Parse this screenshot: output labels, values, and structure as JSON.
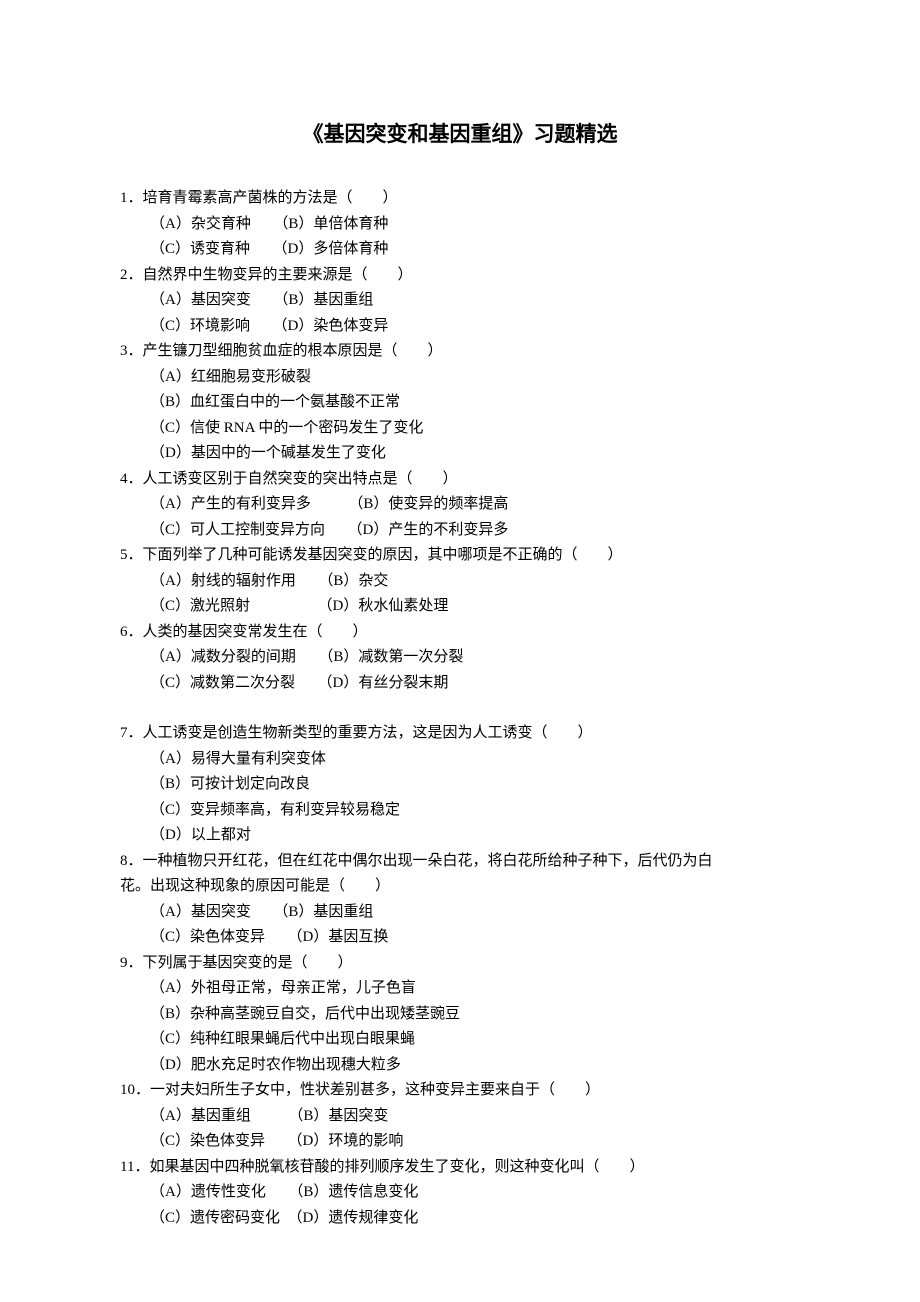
{
  "title": "《基因突变和基因重组》习题精选",
  "questions": [
    {
      "stem": "1．培育青霉素高产菌株的方法是（　　）",
      "options": [
        "（A）杂交育种　　（B）单倍体育种",
        "（C）诱变育种　　（D）多倍体育种"
      ]
    },
    {
      "stem": "2．自然界中生物变异的主要来源是（　　）",
      "options": [
        "（A）基因突变　　（B）基因重组",
        "（C）环境影响　　（D）染色体变异"
      ]
    },
    {
      "stem": "3．产生镰刀型细胞贫血症的根本原因是（　　）",
      "options": [
        "（A）红细胞易变形破裂",
        "（B）血红蛋白中的一个氨基酸不正常",
        "（C）信使 RNA 中的一个密码发生了变化",
        "（D）基因中的一个碱基发生了变化"
      ]
    },
    {
      "stem": "4．人工诱变区别于自然突变的突出特点是（　　）",
      "options": [
        "（A）产生的有利变异多　　　（B）使变异的频率提高",
        "（C）可人工控制变异方向　　（D）产生的不利变异多"
      ]
    },
    {
      "stem": "5．下面列举了几种可能诱发基因突变的原因，其中哪项是不正确的（　　）",
      "options": [
        "（A）射线的辐射作用　　（B）杂交",
        "（C）激光照射　　　　　（D）秋水仙素处理"
      ]
    },
    {
      "stem": "6．人类的基因突变常发生在（　　）",
      "options": [
        "（A）减数分裂的间期　　（B）减数第一次分裂",
        "（C）减数第二次分裂　　（D）有丝分裂末期"
      ],
      "spacerAfter": true
    },
    {
      "stem": "7．人工诱变是创造生物新类型的重要方法，这是因为人工诱变（　　）",
      "options": [
        "（A）易得大量有利突变体",
        "（B）可按计划定向改良",
        "（C）变异频率高，有利变异较易稳定",
        "（D）以上都对"
      ]
    },
    {
      "stem": "8．一种植物只开红花，但在红花中偶尔出现一朵白花，将白花所给种子种下，后代仍为白",
      "cont": "花。出现这种现象的原因可能是（　　）",
      "options": [
        "（A）基因突变　　（B）基因重组",
        "（C）染色体变异　　（D）基因互换"
      ]
    },
    {
      "stem": "9．下列属于基因突变的是（　　）",
      "options": [
        "（A）外祖母正常，母亲正常，儿子色盲",
        "（B）杂种高茎豌豆自交，后代中出现矮茎豌豆",
        "（C）纯种红眼果蝇后代中出现白眼果蝇",
        "（D）肥水充足时农作物出现穗大粒多"
      ]
    },
    {
      "stem": "10．一对夫妇所生子女中，性状差别甚多，这种变异主要来自于（　　）",
      "options": [
        "（A）基因重组　　　（B）基因突变",
        "（C）染色体变异　　（D）环境的影响"
      ]
    },
    {
      "stem": "11．如果基因中四种脱氧核苷酸的排列顺序发生了变化，则这种变化叫（　　）",
      "options": [
        "（A）遗传性变化　　（B）遗传信息变化",
        "（C）遗传密码变化　（D）遗传规律变化"
      ]
    }
  ]
}
